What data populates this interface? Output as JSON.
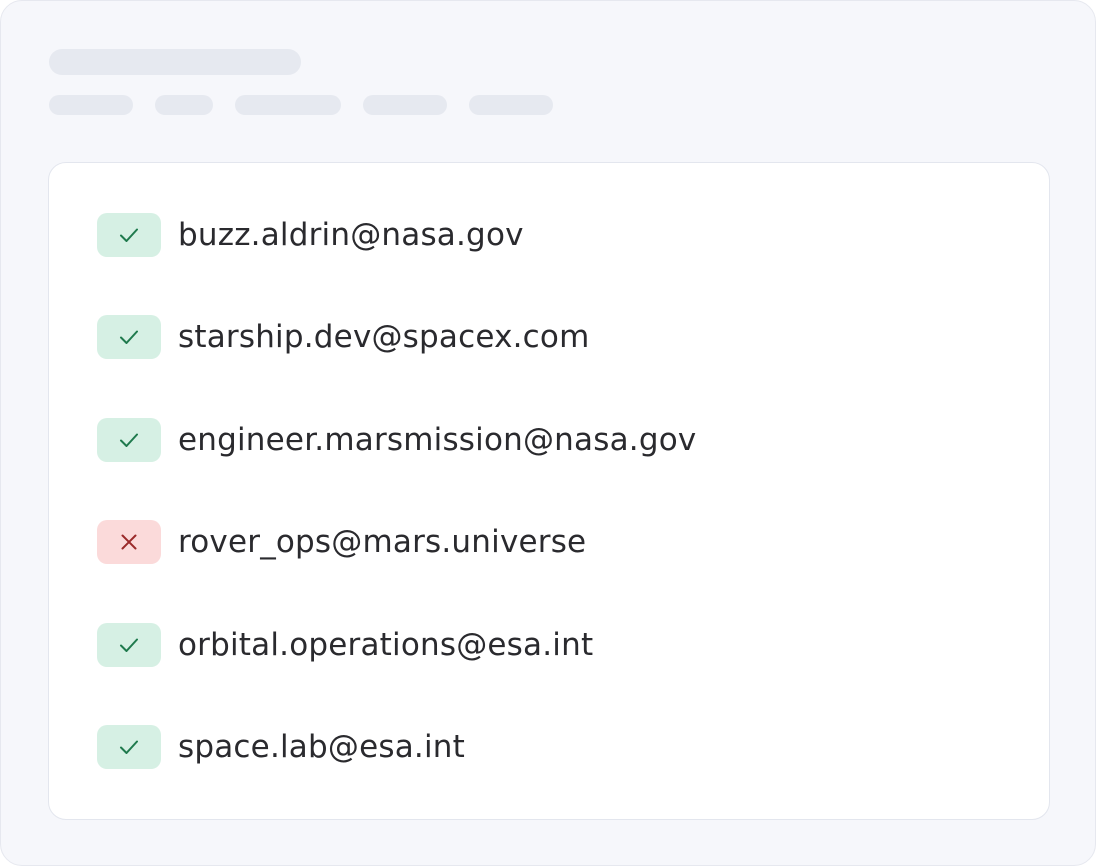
{
  "colors": {
    "valid_badge_bg": "#d6f0e4",
    "valid_icon": "#1f7a4d",
    "invalid_badge_bg": "#fbdada",
    "invalid_icon": "#9b2a2a",
    "text": "#2a2a2e"
  },
  "emails": [
    {
      "address": "buzz.aldrin@nasa.gov",
      "status": "valid",
      "icon": "check-icon"
    },
    {
      "address": "starship.dev@spacex.com",
      "status": "valid",
      "icon": "check-icon"
    },
    {
      "address": "engineer.marsmission@nasa.gov",
      "status": "valid",
      "icon": "check-icon"
    },
    {
      "address": "rover_ops@mars.universe",
      "status": "invalid",
      "icon": "close-icon"
    },
    {
      "address": "orbital.operations@esa.int",
      "status": "valid",
      "icon": "check-icon"
    },
    {
      "address": "space.lab@esa.int",
      "status": "valid",
      "icon": "check-icon"
    }
  ]
}
